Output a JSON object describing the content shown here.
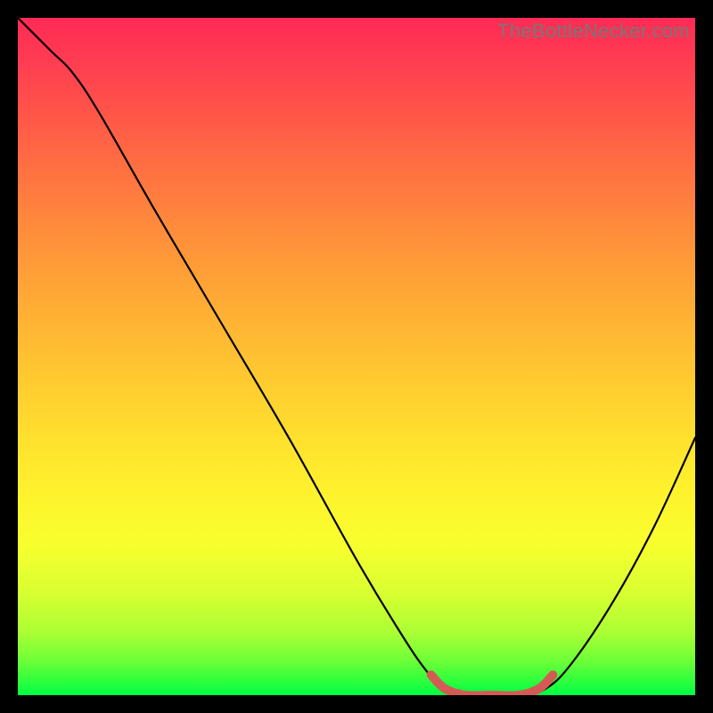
{
  "watermark": "TheBottleNecker.com",
  "chart_data": {
    "type": "line",
    "title": "",
    "xlabel": "",
    "ylabel": "",
    "x_range": [
      0,
      100
    ],
    "y_range": [
      0,
      100
    ],
    "series": [
      {
        "name": "bottleneck-curve",
        "color": "#000000",
        "points": [
          {
            "x": 0,
            "y": 100
          },
          {
            "x": 5,
            "y": 95
          },
          {
            "x": 8,
            "y": 92
          },
          {
            "x": 12,
            "y": 86
          },
          {
            "x": 20,
            "y": 72
          },
          {
            "x": 30,
            "y": 55
          },
          {
            "x": 40,
            "y": 38
          },
          {
            "x": 50,
            "y": 20
          },
          {
            "x": 56,
            "y": 10
          },
          {
            "x": 60,
            "y": 4
          },
          {
            "x": 63,
            "y": 1
          },
          {
            "x": 67,
            "y": 0
          },
          {
            "x": 74,
            "y": 0
          },
          {
            "x": 78,
            "y": 1
          },
          {
            "x": 82,
            "y": 5
          },
          {
            "x": 88,
            "y": 14
          },
          {
            "x": 94,
            "y": 25
          },
          {
            "x": 100,
            "y": 38
          }
        ]
      },
      {
        "name": "optimal-zone",
        "color": "#d45a55",
        "points": [
          {
            "x": 61,
            "y": 3
          },
          {
            "x": 63,
            "y": 1
          },
          {
            "x": 66,
            "y": 0
          },
          {
            "x": 70,
            "y": 0
          },
          {
            "x": 74,
            "y": 0
          },
          {
            "x": 77,
            "y": 1
          },
          {
            "x": 79,
            "y": 3
          }
        ]
      }
    ],
    "highlight_x_range": [
      61,
      79
    ]
  }
}
